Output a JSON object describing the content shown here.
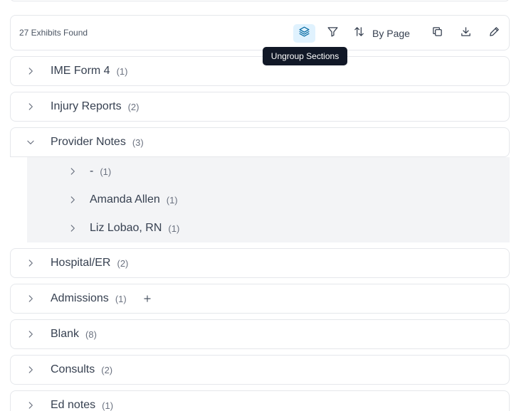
{
  "toolbar": {
    "exhibits_found": "27 Exhibits Found",
    "sort_label": "By Page",
    "tooltip": "Ungroup Sections",
    "icons": {
      "group": "layers-icon",
      "filter": "filter-icon",
      "sort": "sort-arrows-icon",
      "copy": "copy-icon",
      "download": "download-icon",
      "edit": "pencil-icon"
    },
    "active_color": "#0369a1"
  },
  "sections": [
    {
      "title": "IME Form 4",
      "count": "(1)",
      "expanded": false
    },
    {
      "title": "Injury Reports",
      "count": "(2)",
      "expanded": false
    },
    {
      "title": "Provider Notes",
      "count": "(3)",
      "expanded": true,
      "children": [
        {
          "title": "-",
          "count": "(1)"
        },
        {
          "title": "Amanda Allen",
          "count": "(1)"
        },
        {
          "title": "Liz Lobao, RN",
          "count": "(1)"
        }
      ]
    },
    {
      "title": "Hospital/ER",
      "count": "(2)",
      "expanded": false
    },
    {
      "title": "Admissions",
      "count": "(1)",
      "expanded": false,
      "has_add": true
    },
    {
      "title": "Blank",
      "count": "(8)",
      "expanded": false
    },
    {
      "title": "Consults",
      "count": "(2)",
      "expanded": false
    },
    {
      "title": "Ed notes",
      "count": "(1)",
      "expanded": false
    }
  ]
}
